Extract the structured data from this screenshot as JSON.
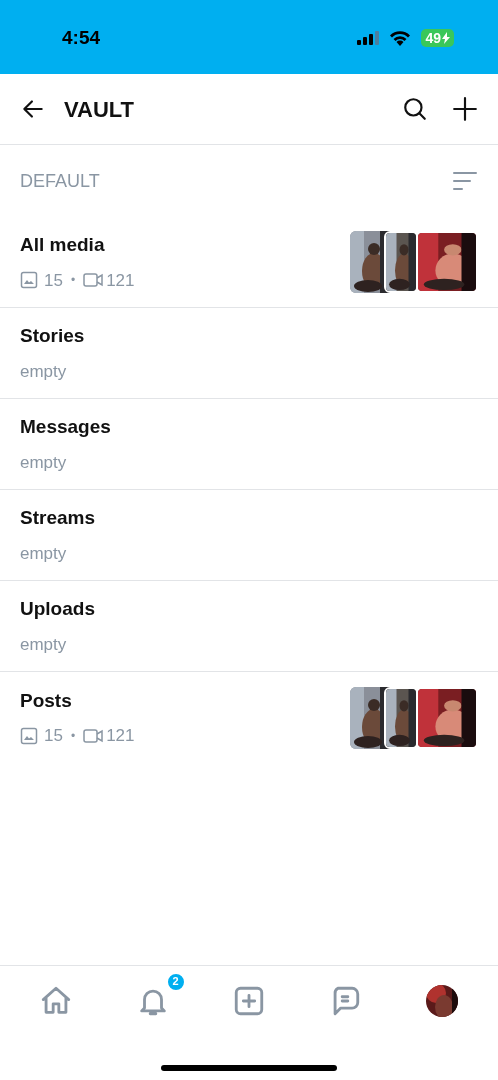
{
  "status_bar": {
    "time": "4:54",
    "battery": "49"
  },
  "header": {
    "title": "VAULT"
  },
  "section": {
    "title": "DEFAULT"
  },
  "lists": [
    {
      "kind": "counts",
      "title": "All media",
      "photos": "15",
      "separator": "•",
      "videos": "121"
    },
    {
      "kind": "empty",
      "title": "Stories",
      "subtitle": "empty"
    },
    {
      "kind": "empty",
      "title": "Messages",
      "subtitle": "empty"
    },
    {
      "kind": "empty",
      "title": "Streams",
      "subtitle": "empty"
    },
    {
      "kind": "empty",
      "title": "Uploads",
      "subtitle": "empty"
    },
    {
      "kind": "counts",
      "title": "Posts",
      "photos": "15",
      "separator": "•",
      "videos": "121"
    }
  ],
  "nav": [
    {
      "kind": "home"
    },
    {
      "kind": "bell",
      "badge": "2"
    },
    {
      "kind": "add"
    },
    {
      "kind": "chat"
    },
    {
      "kind": "avatar"
    }
  ]
}
